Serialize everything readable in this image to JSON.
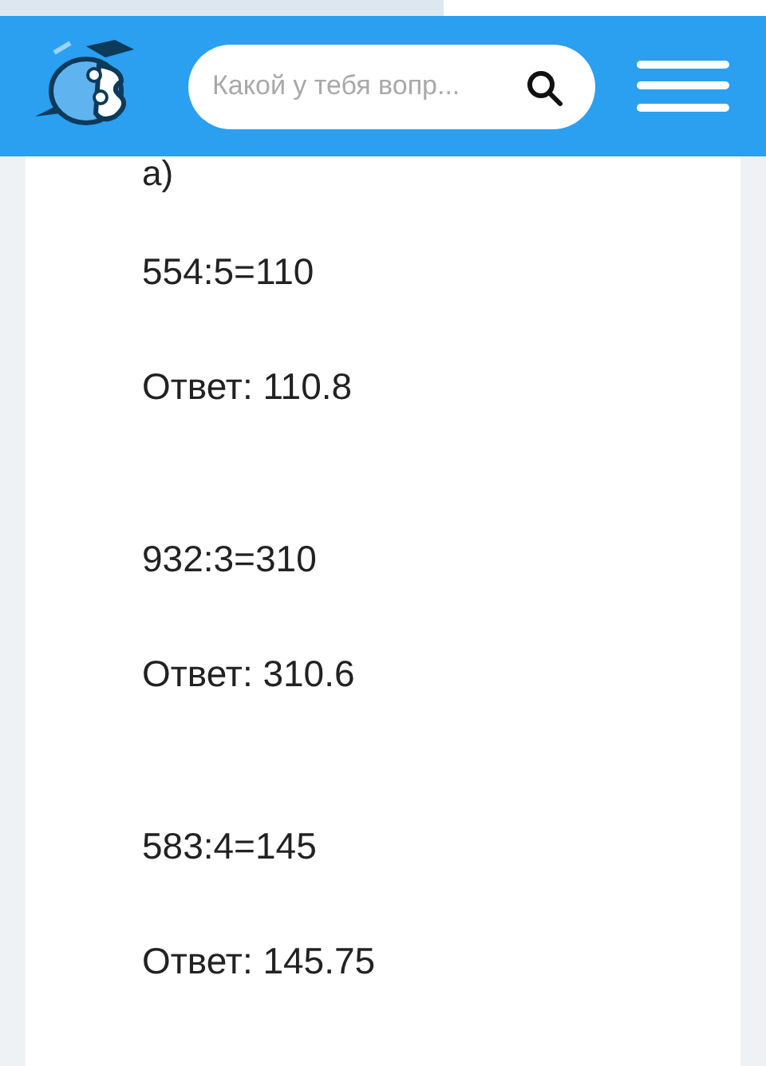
{
  "header": {
    "search": {
      "placeholder": "Какой у тебя вопр..."
    }
  },
  "answer": {
    "part_label": "а)",
    "groups": [
      {
        "expression": "554:5=110",
        "result": "Ответ: 110.8"
      },
      {
        "expression": "932:3=310",
        "result": "Ответ: 310.6"
      },
      {
        "expression": "583:4=145",
        "result": "Ответ: 145.75"
      }
    ]
  }
}
